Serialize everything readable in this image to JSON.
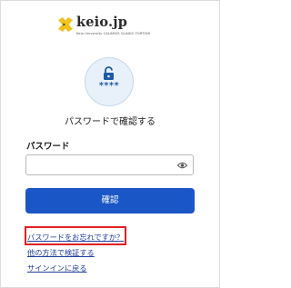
{
  "brand": {
    "name": "keio.jp",
    "tagline": "Keio University  CALAMVS GLADIO FORTIOR"
  },
  "auth": {
    "password_mask": "****",
    "heading": "パスワードで確認する",
    "password_label": "パスワード",
    "password_value": "",
    "submit_label": "確認"
  },
  "links": {
    "forgot_password": "パスワードをお忘れですか？",
    "other_method": "他の方法で検証する",
    "back_to_signin": "サインインに戻る"
  },
  "colors": {
    "primary": "#1a56c6",
    "highlight": "#e0201f",
    "logo_mark": "#f2c21b"
  },
  "icons": {
    "logo": "keio-pen-cross-icon",
    "lock": "unlock-icon",
    "show_password": "eye-icon"
  }
}
